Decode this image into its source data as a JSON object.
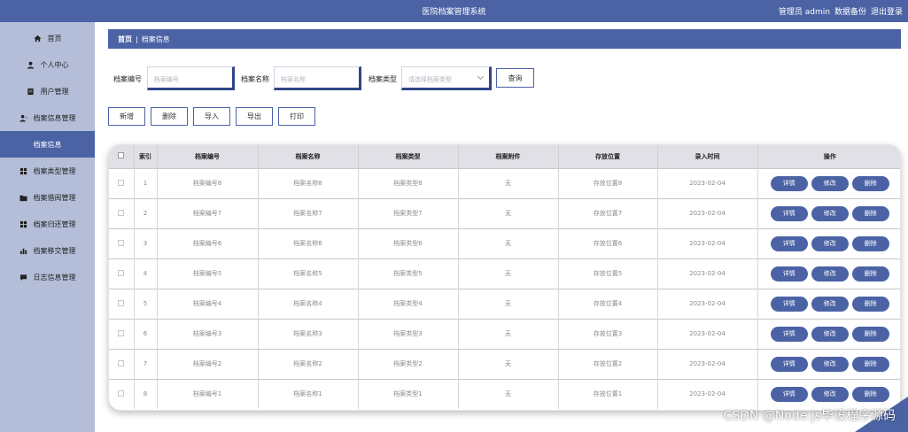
{
  "header": {
    "app_title": "医院档案管理系统",
    "user_role": "管理员 admin",
    "backup_label": "数据备份",
    "logout_label": "退出登录"
  },
  "sidebar": {
    "items": [
      {
        "label": "首页",
        "icon": "home-icon"
      },
      {
        "label": "个人中心",
        "icon": "user-icon"
      },
      {
        "label": "用户管理",
        "icon": "doc-icon"
      },
      {
        "label": "档案信息管理",
        "icon": "person-icon"
      },
      {
        "label": "档案信息",
        "icon": "",
        "active": true
      },
      {
        "label": "档案类型管理",
        "icon": "grid-icon"
      },
      {
        "label": "档案借阅管理",
        "icon": "folder-icon"
      },
      {
        "label": "档案归还管理",
        "icon": "grid-icon"
      },
      {
        "label": "档案移交管理",
        "icon": "bar-chart-icon"
      },
      {
        "label": "日志信息管理",
        "icon": "message-icon"
      }
    ]
  },
  "breadcrumb": {
    "home": "首页",
    "separator": "|",
    "current": "档案信息"
  },
  "search": {
    "code_label": "档案编号",
    "code_placeholder": "档案编号",
    "name_label": "档案名称",
    "name_placeholder": "档案名称",
    "type_label": "档案类型",
    "type_placeholder": "请选择档案类型",
    "query_label": "查询"
  },
  "actions": {
    "add": "新增",
    "delete": "删除",
    "import": "导入",
    "export": "导出",
    "print": "打印"
  },
  "table": {
    "headers": {
      "index": "索引",
      "code": "档案编号",
      "name": "档案名称",
      "type": "档案类型",
      "attachment": "档案附件",
      "location": "存放位置",
      "entry_time": "录入时间",
      "ops": "操作"
    },
    "op_labels": {
      "detail": "详情",
      "edit": "修改",
      "delete": "删除"
    },
    "rows": [
      {
        "index": "1",
        "code": "档案编号8",
        "name": "档案名称8",
        "type": "档案类型8",
        "attachment": "无",
        "location": "存放位置8",
        "entry_time": "2023-02-04"
      },
      {
        "index": "2",
        "code": "档案编号7",
        "name": "档案名称7",
        "type": "档案类型7",
        "attachment": "无",
        "location": "存放位置7",
        "entry_time": "2023-02-04"
      },
      {
        "index": "3",
        "code": "档案编号6",
        "name": "档案名称6",
        "type": "档案类型6",
        "attachment": "无",
        "location": "存放位置6",
        "entry_time": "2023-02-04"
      },
      {
        "index": "4",
        "code": "档案编号5",
        "name": "档案名称5",
        "type": "档案类型5",
        "attachment": "无",
        "location": "存放位置5",
        "entry_time": "2023-02-04"
      },
      {
        "index": "5",
        "code": "档案编号4",
        "name": "档案名称4",
        "type": "档案类型4",
        "attachment": "无",
        "location": "存放位置4",
        "entry_time": "2023-02-04"
      },
      {
        "index": "6",
        "code": "档案编号3",
        "name": "档案名称3",
        "type": "档案类型3",
        "attachment": "无",
        "location": "存放位置3",
        "entry_time": "2023-02-04"
      },
      {
        "index": "7",
        "code": "档案编号2",
        "name": "档案名称2",
        "type": "档案类型2",
        "attachment": "无",
        "location": "存放位置2",
        "entry_time": "2023-02-04"
      },
      {
        "index": "8",
        "code": "档案编号1",
        "name": "档案名称1",
        "type": "档案类型1",
        "attachment": "无",
        "location": "存放位置1",
        "entry_time": "2023-02-04"
      }
    ]
  },
  "watermark": "CSDN @Node.js毕设程序源码",
  "colors": {
    "primary": "#4b63a5",
    "sidebar": "#b4bed8"
  }
}
